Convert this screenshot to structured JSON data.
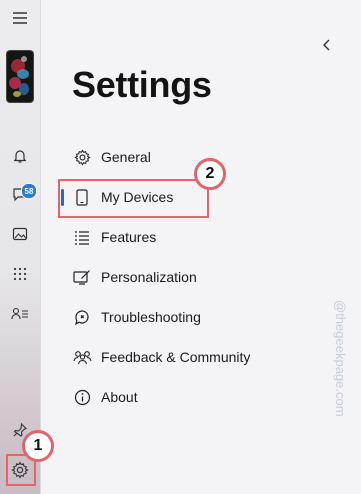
{
  "rail": {
    "items": [
      {
        "name": "hamburger-menu-icon"
      },
      {
        "name": "notifications-icon"
      },
      {
        "name": "messages-icon"
      },
      {
        "name": "photos-icon"
      },
      {
        "name": "apps-icon"
      },
      {
        "name": "contacts-icon"
      },
      {
        "name": "pin-icon"
      },
      {
        "name": "settings-icon"
      }
    ],
    "messages_badge": "58"
  },
  "page": {
    "title": "Settings",
    "back_icon": "chevron-left-icon"
  },
  "nav": {
    "selected": "My Devices",
    "items": [
      {
        "label": "General",
        "icon": "gear-icon"
      },
      {
        "label": "My Devices",
        "icon": "phone-icon"
      },
      {
        "label": "Features",
        "icon": "list-icon"
      },
      {
        "label": "Personalization",
        "icon": "paint-icon"
      },
      {
        "label": "Troubleshooting",
        "icon": "troubleshoot-icon"
      },
      {
        "label": "Feedback & Community",
        "icon": "people-icon"
      },
      {
        "label": "About",
        "icon": "info-icon"
      }
    ]
  },
  "annotations": {
    "step1": "1",
    "step2": "2",
    "color": "#e0666a"
  },
  "watermark": "@thegeekpage.com",
  "colors": {
    "accent": "#2a66c8",
    "badge": "#2a7bd6"
  }
}
